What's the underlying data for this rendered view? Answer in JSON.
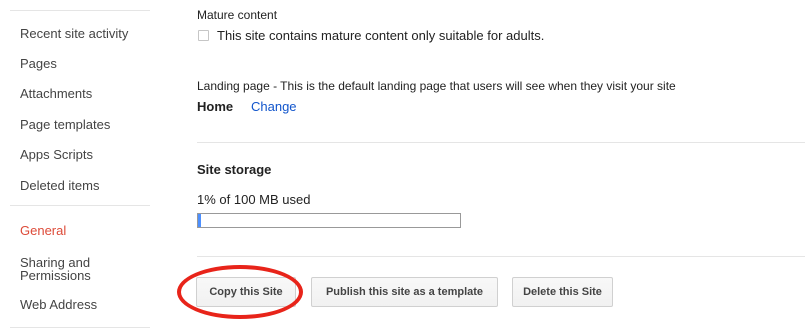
{
  "sidebar": {
    "items": [
      {
        "label": "Recent site activity"
      },
      {
        "label": "Pages"
      },
      {
        "label": "Attachments"
      },
      {
        "label": "Page templates"
      },
      {
        "label": "Apps Scripts"
      },
      {
        "label": "Deleted items"
      },
      {
        "label": "General",
        "active": true
      },
      {
        "label_line1": "Sharing and",
        "label_line2": "Permissions"
      },
      {
        "label": "Web Address"
      }
    ]
  },
  "mature": {
    "heading": "Mature content",
    "checkbox_label": "This site contains mature content only suitable for adults.",
    "checked": false
  },
  "landing": {
    "description": "Landing page - This is the default landing page that users will see when they visit your site",
    "current_page": "Home",
    "change_link": "Change"
  },
  "storage": {
    "heading": "Site storage",
    "usage_text": "1% of 100 MB used",
    "used_fraction": 0.01
  },
  "actions": {
    "copy_label": "Copy this Site",
    "publish_label": "Publish this site as a template",
    "delete_label": "Delete this Site"
  },
  "colors": {
    "active_nav": "#dd4b39",
    "link": "#1155cc",
    "annotation": "#e8241a"
  }
}
